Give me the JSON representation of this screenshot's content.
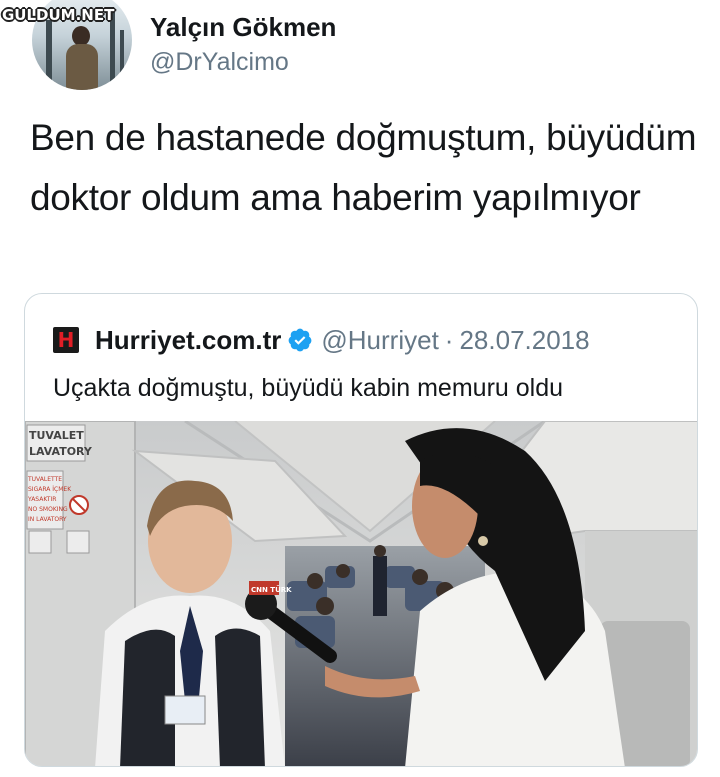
{
  "watermark": "GULDUM.NET",
  "author": {
    "display_name": "Yalçın Gökmen",
    "handle": "@DrYalcimo"
  },
  "tweet_text": "Ben de hastanede doğmuştum, büyüdüm doktor oldum ama haberim yapılmıyor",
  "quoted_tweet": {
    "logo_icon": "hurriyet-logo",
    "display_name": "Hurriyet.com.tr",
    "verified_icon": "verified-badge-icon",
    "handle": "@Hurriyet",
    "separator": "·",
    "date": "28.07.2018",
    "text": "Uçakta doğmuştu, büyüdü kabin memuru oldu"
  },
  "photo": {
    "sign_lines": [
      "TUVALET",
      "LAVATORY"
    ],
    "sign_small_lines": [
      "TUVALETTE",
      "SIGARA İÇMEK",
      "YASAKTIR",
      "NO SMOKING",
      "IN LAVATORY"
    ],
    "mic_label": "CNN TÜRK"
  },
  "colors": {
    "text": "#14171a",
    "secondary": "#657786",
    "verified": "#1da1f2",
    "border": "#cfd9de",
    "hurriyet_red": "#e21e26"
  }
}
